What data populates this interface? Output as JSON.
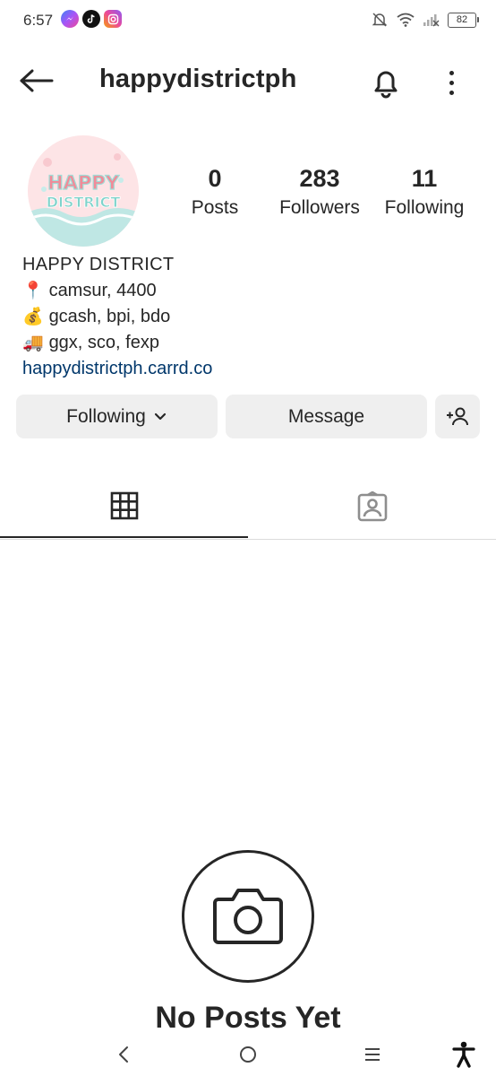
{
  "status_bar": {
    "time": "6:57",
    "battery": "82",
    "apps": [
      "messenger-icon",
      "tiktok-icon",
      "instagram-icon"
    ]
  },
  "header": {
    "username": "happydistrictph"
  },
  "profile": {
    "avatar_text": "HAPPY DISTRICT",
    "stats": [
      {
        "value": "0",
        "label": "Posts"
      },
      {
        "value": "283",
        "label": "Followers"
      },
      {
        "value": "11",
        "label": "Following"
      }
    ]
  },
  "bio": {
    "name": "HAPPY DISTRICT",
    "lines": [
      {
        "emoji": "📍",
        "text": "camsur, 4400"
      },
      {
        "emoji": "💰",
        "text": "gcash, bpi, bdo"
      },
      {
        "emoji": "🚚",
        "text": "ggx, sco, fexp"
      }
    ],
    "link": "happydistrictph.carrd.co"
  },
  "actions": {
    "following_label": "Following",
    "message_label": "Message"
  },
  "empty_state": {
    "title": "No Posts Yet"
  },
  "colors": {
    "link": "#00376b",
    "button_bg": "#efefef",
    "text": "#262626"
  }
}
